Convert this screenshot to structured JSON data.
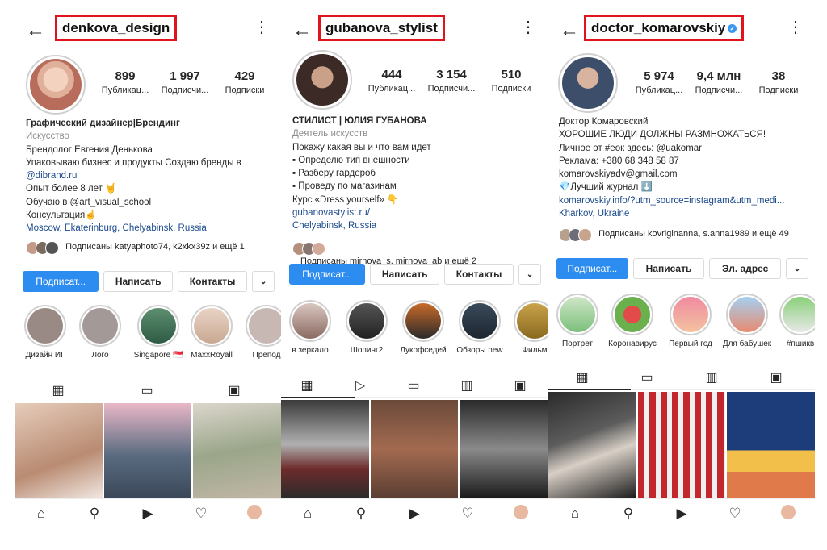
{
  "profiles": [
    {
      "username": "denkova_design",
      "stats": [
        {
          "num": "899",
          "label": "Публикац..."
        },
        {
          "num": "1 997",
          "label": "Подписчи..."
        },
        {
          "num": "429",
          "label": "Подписки"
        }
      ],
      "bio": [
        {
          "text": "Графический дизайнер|Брендинг",
          "style": "b"
        },
        {
          "text": "Искусство",
          "style": "cat"
        },
        {
          "text": "Брендолог Евгения Денькова",
          "style": ""
        },
        {
          "text": "Упаковываю бизнес и продукты   Создаю бренды в",
          "style": ""
        },
        {
          "text": "@dibrand.ru",
          "style": "lnk"
        },
        {
          "text": "Опыт более 8 лет 🤘",
          "style": ""
        },
        {
          "text": "Обучаю в @art_visual_school",
          "style": ""
        },
        {
          "text": "Консультация☝️",
          "style": ""
        },
        {
          "text": "Moscow, Ekaterinburg, Chelyabinsk, Russia",
          "style": "lnk"
        }
      ],
      "followed_by": "Подписаны katyaphoto74, k2xkx39z и ещё 1",
      "buttons": [
        "Подписат...",
        "Написать",
        "Контакты",
        "⌄"
      ],
      "highlights": [
        "Дизайн ИГ",
        "Лого",
        "Singapore 🇸🇬",
        "MaxxRoyall",
        "Препод"
      ],
      "nav": [
        "home-icon",
        "search-icon",
        "reels-icon",
        "heart-icon",
        "profile-avatar"
      ]
    },
    {
      "username": "gubanova_stylist",
      "stats": [
        {
          "num": "444",
          "label": "Публикац..."
        },
        {
          "num": "3 154",
          "label": "Подписчи..."
        },
        {
          "num": "510",
          "label": "Подписки"
        }
      ],
      "bio": [
        {
          "text": "СТИЛИСТ | ЮЛИЯ ГУБАНОВА",
          "style": "b"
        },
        {
          "text": "Деятель искусств",
          "style": "cat"
        },
        {
          "text": "Покажу какая вы и что вам идет",
          "style": ""
        },
        {
          "text": "▪ Определю тип внешности",
          "style": ""
        },
        {
          "text": "▪ Разберу гардероб",
          "style": ""
        },
        {
          "text": "▪ Проведу по магазинам",
          "style": ""
        },
        {
          "text": "Курс «Dress yourself» 👇",
          "style": ""
        },
        {
          "text": "gubanovastylist.ru/",
          "style": "lnk"
        },
        {
          "text": "Chelyabinsk, Russia",
          "style": "lnk"
        }
      ],
      "followed_by": "Подписаны mirnova_s, mirnova_ab и ещё 2",
      "buttons": [
        "Подписат...",
        "Написать",
        "Контакты",
        "⌄"
      ],
      "highlights": [
        "в зеркало",
        "Шопинг2",
        "Лукофседей",
        "Обзоры new",
        "Фильм"
      ]
    },
    {
      "username": "doctor_komarovskiy",
      "stats": [
        {
          "num": "5 974",
          "label": "Публикац..."
        },
        {
          "num": "9,4 млн",
          "label": "Подписчи..."
        },
        {
          "num": "38",
          "label": "Подписки"
        }
      ],
      "bio": [
        {
          "text": "Доктор Комаровский",
          "style": ""
        },
        {
          "text": "ХОРОШИЕ ЛЮДИ ДОЛЖНЫ РАЗМНОЖАТЬСЯ!",
          "style": ""
        },
        {
          "text": "Личное от #еок здесь: @uakomar",
          "style": ""
        },
        {
          "text": "Реклама: +380 68 348 58 87",
          "style": ""
        },
        {
          "text": "komarovskiyadv@gmail.com",
          "style": ""
        },
        {
          "text": "💎Лучший журнал ⬇️",
          "style": ""
        },
        {
          "text": "komarovskiy.info/?utm_source=instagram&utm_medi...",
          "style": "lnk"
        },
        {
          "text": "Kharkov, Ukraine",
          "style": "lnk"
        }
      ],
      "followed_by": "Подписаны kovriginanna, s.anna1989 и ещё 49",
      "buttons": [
        "Подписат...",
        "Написать",
        "Эл. адрес",
        "⌄"
      ],
      "highlights": [
        "Портрет",
        "Коронавирус",
        "Первый год",
        "Для бабушек",
        "#пшикв"
      ]
    }
  ],
  "colors": {
    "primary_button": "#2d8cf0",
    "red_frame": "#e0141e",
    "link": "#1b4a8c"
  }
}
